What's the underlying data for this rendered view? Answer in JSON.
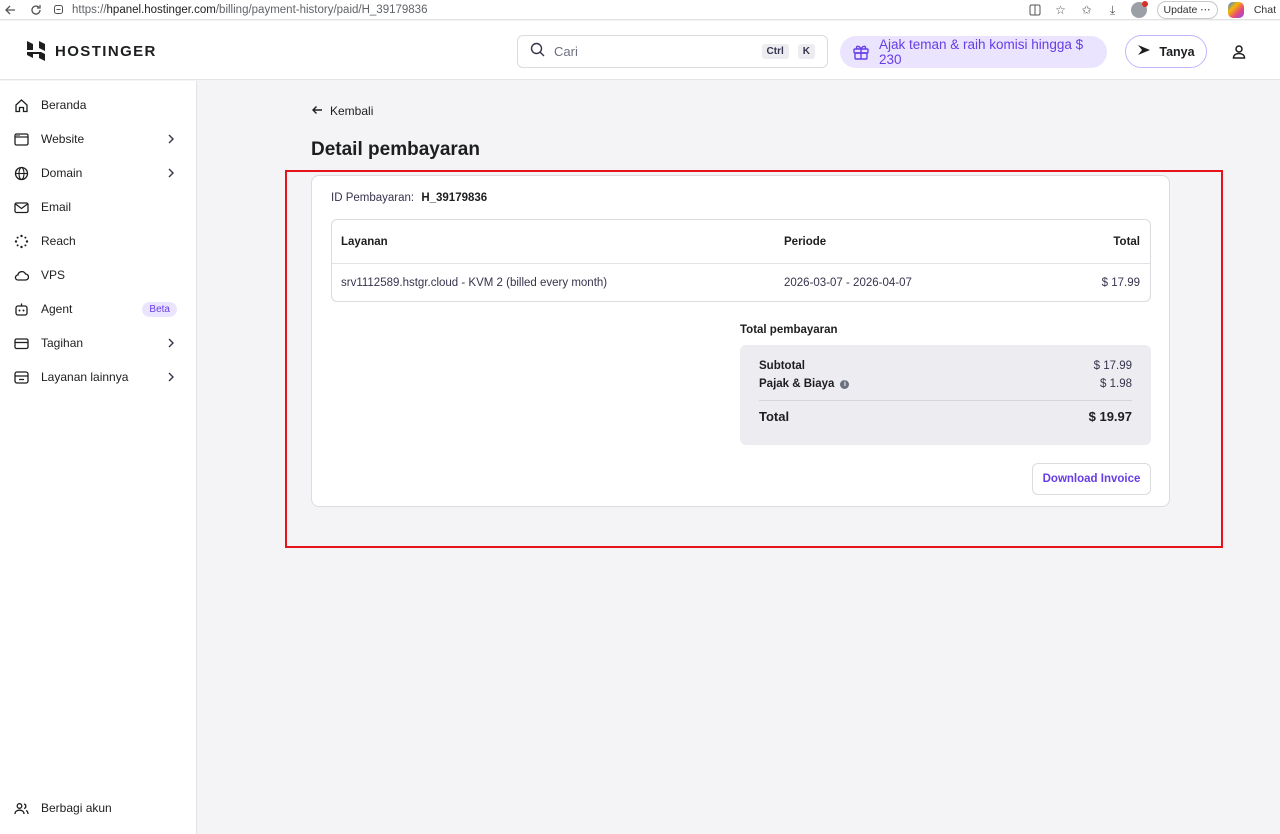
{
  "browser": {
    "url_prefix": "https://",
    "url_host": "hpanel.hostinger.com",
    "url_path": "/billing/payment-history/paid/H_39179836",
    "update_label": "Update",
    "chat_label": "Chat"
  },
  "header": {
    "brand": "HOSTINGER",
    "search_placeholder": "Cari",
    "kbd_ctrl": "Ctrl",
    "kbd_k": "K",
    "referral": "Ajak teman & raih komisi hingga $ 230",
    "ask_label": "Tanya"
  },
  "sidebar": {
    "items": [
      {
        "label": "Beranda",
        "icon": "home-icon"
      },
      {
        "label": "Website",
        "icon": "browser-window-icon"
      },
      {
        "label": "Domain",
        "icon": "globe-icon"
      },
      {
        "label": "Email",
        "icon": "mail-icon"
      },
      {
        "label": "Reach",
        "icon": "sparkle-icon"
      },
      {
        "label": "VPS",
        "icon": "cloud-icon"
      },
      {
        "label": "Agent",
        "icon": "robot-icon",
        "badge": "Beta"
      },
      {
        "label": "Tagihan",
        "icon": "credit-card-icon"
      },
      {
        "label": "Layanan lainnya",
        "icon": "store-icon"
      }
    ],
    "footer_label": "Berbagi akun"
  },
  "main": {
    "back_label": "Kembali",
    "title": "Detail pembayaran",
    "payment_id_label": "ID Pembayaran:",
    "payment_id": "H_39179836",
    "table": {
      "headers": [
        "Layanan",
        "Periode",
        "Total"
      ],
      "rows": [
        {
          "service": "srv1112589.hstgr.cloud - KVM 2 (billed every month)",
          "period": "2026-03-07 - 2026-04-07",
          "total": "$ 17.99"
        }
      ]
    },
    "summary": {
      "title": "Total pembayaran",
      "subtotal_label": "Subtotal",
      "subtotal": "$ 17.99",
      "tax_label": "Pajak & Biaya",
      "tax": "$ 1.98",
      "total_label": "Total",
      "total": "$ 19.97"
    },
    "download_label": "Download Invoice"
  },
  "colors": {
    "accent": "#673de6",
    "highlight": "#e5131a"
  }
}
